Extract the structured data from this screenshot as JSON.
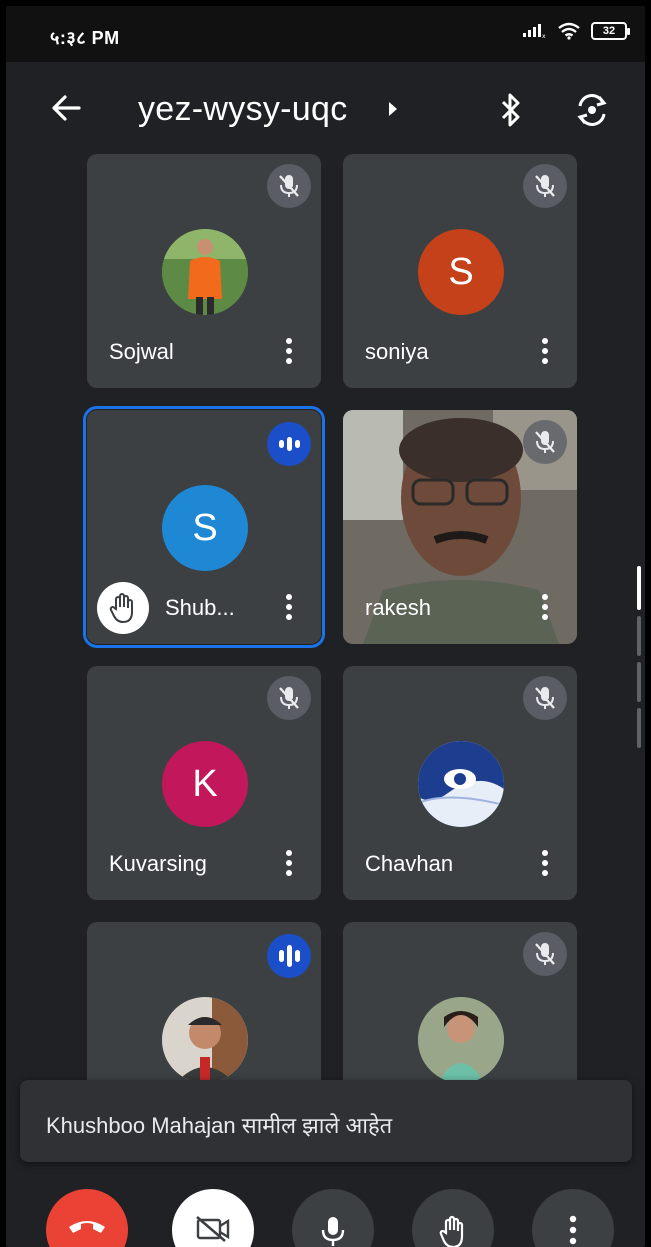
{
  "status_bar": {
    "time": "५:३८ PM",
    "battery": "32"
  },
  "header": {
    "meeting_code": "yez-wysy-uqc"
  },
  "participants": [
    {
      "name": "Sojwal",
      "state": "muted",
      "avatar": "photo-orange"
    },
    {
      "name": "soniya",
      "state": "muted",
      "avatar_letter": "S",
      "avatar_color": "#c5411a"
    },
    {
      "name": "Shub...",
      "state": "speaking",
      "avatar_letter": "S",
      "avatar_color": "#1e88d4",
      "hand_raised": true
    },
    {
      "name": "rakesh",
      "state": "muted",
      "avatar": "camera-video"
    },
    {
      "name": "Kuvarsing",
      "state": "muted",
      "avatar_letter": "K",
      "avatar_color": "#c2185b"
    },
    {
      "name": "Chavhan",
      "state": "muted",
      "avatar": "eye-logo"
    },
    {
      "name": "",
      "state": "speaking",
      "avatar": "photo-man"
    },
    {
      "name": "",
      "state": "muted",
      "avatar": "photo-woman"
    }
  ],
  "toast": {
    "message": "Khushboo Mahajan सामील झाले आहेत"
  },
  "controls": {
    "end_call_color": "#ea4335",
    "camera_off_bg": "#ffffff",
    "secondary_bg": "#3c4043"
  }
}
